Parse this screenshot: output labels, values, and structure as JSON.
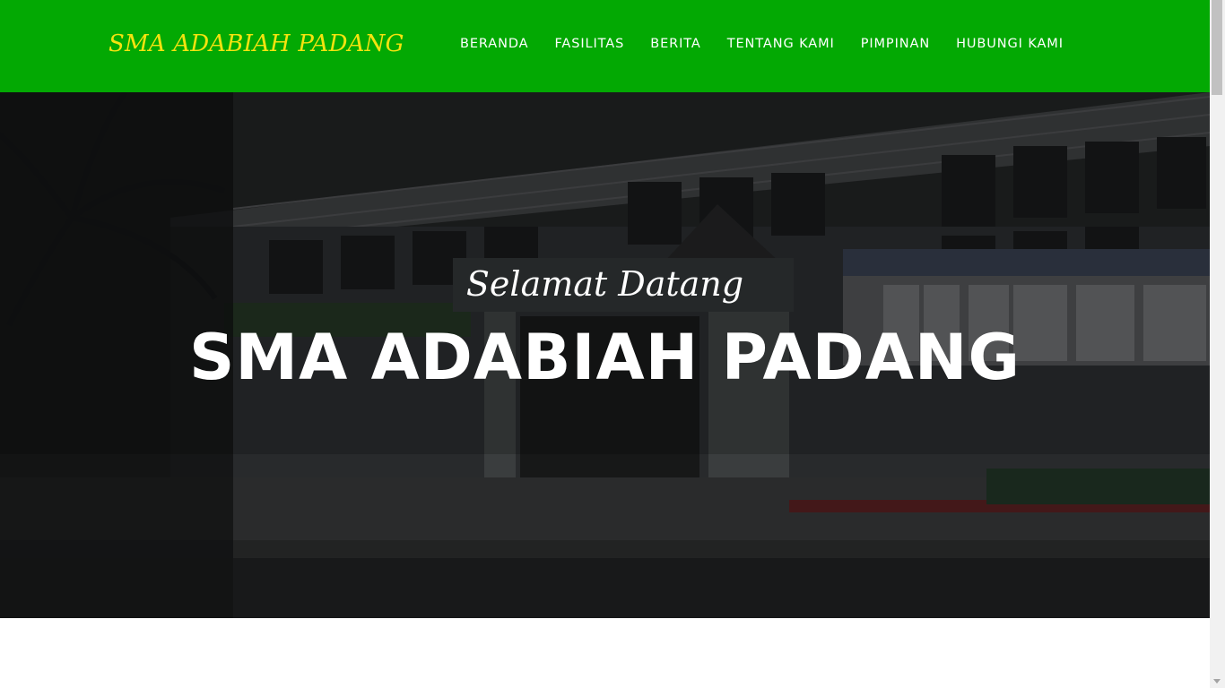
{
  "brand": {
    "name": "SMA ADABIAH PADANG"
  },
  "nav": {
    "items": [
      {
        "label": "BERANDA"
      },
      {
        "label": "FASILITAS"
      },
      {
        "label": "BERITA"
      },
      {
        "label": "TENTANG KAMI"
      },
      {
        "label": "PIMPINAN"
      },
      {
        "label": "HUBUNGI KAMI"
      }
    ]
  },
  "hero": {
    "subtitle": "Selamat Datang",
    "title": "SMA ADABIAH PADANG"
  },
  "colors": {
    "navbar_bg": "#03a903",
    "brand_text": "#f4e30f",
    "nav_text": "#ffffff"
  },
  "icons": {
    "scroll_down": "chevron-down-icon"
  }
}
